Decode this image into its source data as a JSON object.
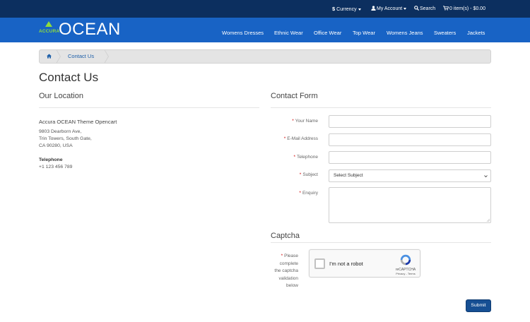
{
  "topbar": {
    "currency_symbol": "$",
    "currency_label": "Currency",
    "account_label": "My Account",
    "search_label": "Search",
    "cart_label": "0 item(s) - $0.00"
  },
  "header": {
    "logo_small": "ACCURA",
    "logo_big": "OCEAN",
    "nav": [
      "Womens Dresses",
      "Ethnic Wear",
      "Office Wear",
      "Top Wear",
      "Womens Jeans",
      "Sweaters",
      "Jackets"
    ]
  },
  "breadcrumb": {
    "current": "Contact Us"
  },
  "page": {
    "title": "Contact Us"
  },
  "location": {
    "heading": "Our Location",
    "store_name": "Accura OCEAN Theme Opencart",
    "address_lines": [
      "9803 Dearborn Ave,",
      "Trin Towers, South Gate,",
      "CA 90280, USA"
    ],
    "phone_label": "Telephone",
    "phone_value": "+1 123 456 789"
  },
  "form": {
    "heading": "Contact Form",
    "name_label": "Your Name",
    "email_label": "E-Mail Address",
    "telephone_label": "Telephone",
    "subject_label": "Subject",
    "subject_selected": "Select Subject",
    "enquiry_label": "Enquiry",
    "captcha_heading": "Captcha",
    "captcha_label_lines": [
      "Please",
      "complete",
      "the captcha",
      "validation",
      "below"
    ],
    "recaptcha_text": "I'm not a robot",
    "recaptcha_brand": "reCAPTCHA",
    "recaptcha_links": "Privacy - Terms",
    "submit_label": "Submit",
    "required_mark": "*"
  },
  "colors": {
    "topbar": "#0c2f5f",
    "header": "#1863c5",
    "accent_green": "#8fdc3c",
    "link": "#1c5ea8",
    "submit": "#164f93",
    "required": "#d00000"
  }
}
